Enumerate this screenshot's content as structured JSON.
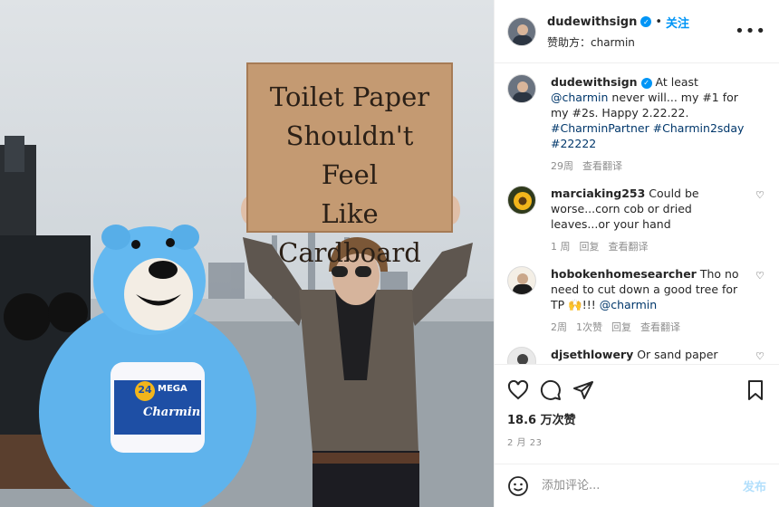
{
  "header": {
    "username": "dudewithsign",
    "dot": "•",
    "follow_label": "关注",
    "sponsor": "赞助方：charmin",
    "more": "•••"
  },
  "photo": {
    "sign_lines": [
      "Toilet Paper",
      "Shouldn't Feel",
      "Like",
      "Cardboard"
    ],
    "package_badge": "24",
    "package_text": "MEGA",
    "package_brand": "Charmin"
  },
  "caption": {
    "username": "dudewithsign",
    "text_1": " At least ",
    "mention": "@charmin",
    "text_2": " never will... my #1 for my #2s. Happy 2.22.22. ",
    "hashtags": "#CharminPartner #Charmin2sday #22222",
    "time": "29周",
    "translate": "查看翻译"
  },
  "comments": [
    {
      "username": "marciaking253",
      "text": " Could be worse...corn cob or dried leaves...or your hand",
      "time": "1 周",
      "likes": "",
      "reply": "回复",
      "translate": "查看翻译"
    },
    {
      "username": "hobokenhomesearcher",
      "text": " Tho no need to cut down a good tree for TP 🙌!!! ",
      "mention": "@charmin",
      "time": "2周",
      "likes": "1次赞",
      "reply": "回复",
      "translate": "查看翻译"
    },
    {
      "username": "djsethlowery",
      "text": " Or sand paper",
      "time": "",
      "likes": "",
      "reply": "",
      "translate": ""
    }
  ],
  "actions": {
    "likes": "18.6 万次赞",
    "date": "2 月 23"
  },
  "add_comment": {
    "placeholder": "添加评论...",
    "post_label": "发布"
  }
}
